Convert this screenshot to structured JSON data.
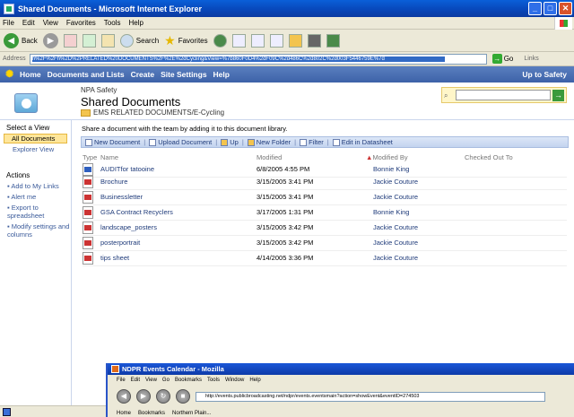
{
  "window": {
    "title": "Shared Documents - Microsoft Internet Explorer",
    "buttons": [
      "_",
      "□",
      "✕"
    ]
  },
  "menu": [
    "File",
    "Edit",
    "View",
    "Favorites",
    "Tools",
    "Help"
  ],
  "toolbar": {
    "back": "Back",
    "search": "Search",
    "favorites": "Favorites"
  },
  "address": {
    "label": "Address",
    "url": "h%2F%2Fh%2D%2PRELATED%20DOCUMENTS%2F%2E%2dCycling&View=%7b860F0D4%2dF09C%2d486C%2d802C%2d003F5446759E%7d",
    "go": "Go",
    "links": "Links"
  },
  "spnav": {
    "items": [
      "Home",
      "Documents and Lists",
      "Create",
      "Site Settings",
      "Help"
    ],
    "right": "Up to Safety"
  },
  "header": {
    "site": "NPA Safety",
    "title": "Shared Documents",
    "breadcrumb": "EMS RELATED DOCUMENTS/E-Cycling"
  },
  "leftnav": {
    "view_head": "Select a View",
    "views": [
      "All Documents",
      "Explorer View"
    ],
    "actions_head": "Actions",
    "actions": [
      "Add to My Links",
      "Alert me",
      "Export to spreadsheet",
      "Modify settings and columns"
    ]
  },
  "main": {
    "description": "Share a document with the team by adding it to this document library.",
    "actionbar": [
      "New Document",
      "Upload Document",
      "Up",
      "New Folder",
      "Filter",
      "Edit in Datasheet"
    ],
    "columns": [
      "Type",
      "Name",
      "Modified",
      "Modified By",
      "Checked Out To"
    ],
    "rows": [
      {
        "icon": "doc",
        "name": "AUDITfor tatooine",
        "modified": "6/8/2005 4:55 PM",
        "by": "Bonnie King"
      },
      {
        "icon": "pdf",
        "name": "Brochure",
        "modified": "3/15/2005 3:41 PM",
        "by": "Jackie Couture"
      },
      {
        "icon": "pdf",
        "name": "Businessletter",
        "modified": "3/15/2005 3:41 PM",
        "by": "Jackie Couture"
      },
      {
        "icon": "pdf",
        "name": "GSA Contract Recyclers",
        "modified": "3/17/2005 1:31 PM",
        "by": "Bonnie King"
      },
      {
        "icon": "pdf",
        "name": "landscape_posters",
        "modified": "3/15/2005 3:42 PM",
        "by": "Jackie Couture"
      },
      {
        "icon": "pdf",
        "name": "posterportrait",
        "modified": "3/15/2005 3:42 PM",
        "by": "Jackie Couture"
      },
      {
        "icon": "pdf",
        "name": "tips sheet",
        "modified": "4/14/2005 3:36 PM",
        "by": "Jackie Couture"
      }
    ]
  },
  "mozilla": {
    "title": "NDPR Events Calendar - Mozilla",
    "menu": [
      "File",
      "Edit",
      "View",
      "Go",
      "Bookmarks",
      "Tools",
      "Window",
      "Help"
    ],
    "url": "http://events.publicbroadcasting.net/ndpr/events.eventsmain?action=showEvent&eventID=274503",
    "bookmarks": [
      "Home",
      "Bookmarks",
      "Northern Plain..."
    ]
  }
}
